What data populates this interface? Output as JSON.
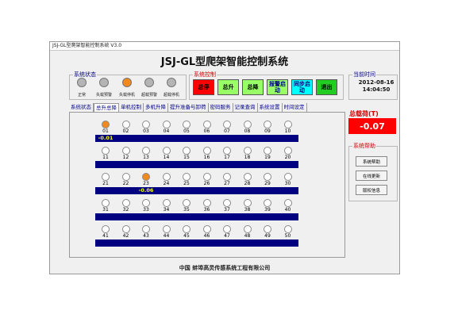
{
  "window": {
    "title": "JSJ-GL型爬架智能控制系统 V3.0"
  },
  "main_title": "JSJ-GL型爬架智能控制系统",
  "status_group": {
    "label": "系统状态",
    "lamps": [
      {
        "label": "正常",
        "color": "#b4b4b4"
      },
      {
        "label": "失载预警",
        "color": "#b4b4b4"
      },
      {
        "label": "失载停机",
        "color": "#f08a1e"
      },
      {
        "label": "超载预警",
        "color": "#b4b4b4"
      },
      {
        "label": "超载停机",
        "color": "#b4b4b4"
      }
    ]
  },
  "control_group": {
    "label": "系统控制",
    "buttons": [
      {
        "label": "总停",
        "bg": "#ff0000",
        "fg": "#000000"
      },
      {
        "label": "总升",
        "bg": "#99ff66",
        "fg": "#000000"
      },
      {
        "label": "总降",
        "bg": "#99ff66",
        "fg": "#000000"
      },
      {
        "label": "报警启动",
        "bg": "#99ff66",
        "fg": "#000080"
      },
      {
        "label": "同步启动",
        "bg": "#00ffff",
        "fg": "#000080"
      },
      {
        "label": "退出",
        "bg": "#22cc22",
        "fg": "#000000"
      }
    ]
  },
  "time_group": {
    "label": "当前时间",
    "date": "2012-08-16",
    "time": "14:04:50"
  },
  "tabs": [
    "系统状态",
    "总升总降",
    "单机控制",
    "多机升降",
    "提升准备与卸荷",
    "密码服务",
    "记录查询",
    "系统设置",
    "时间设定"
  ],
  "active_tab": 1,
  "units": [
    {
      "id": "01",
      "lamp": "#f08a1e",
      "value": "-0.01"
    },
    {
      "id": "02",
      "lamp": "#ffffff",
      "value": ""
    },
    {
      "id": "03",
      "lamp": "#ffffff",
      "value": ""
    },
    {
      "id": "04",
      "lamp": "#ffffff",
      "value": ""
    },
    {
      "id": "05",
      "lamp": "#ffffff",
      "value": ""
    },
    {
      "id": "06",
      "lamp": "#ffffff",
      "value": ""
    },
    {
      "id": "07",
      "lamp": "#ffffff",
      "value": ""
    },
    {
      "id": "08",
      "lamp": "#ffffff",
      "value": ""
    },
    {
      "id": "09",
      "lamp": "#ffffff",
      "value": ""
    },
    {
      "id": "10",
      "lamp": "#ffffff",
      "value": ""
    },
    {
      "id": "11",
      "lamp": "#ffffff",
      "value": ""
    },
    {
      "id": "12",
      "lamp": "#ffffff",
      "value": ""
    },
    {
      "id": "13",
      "lamp": "#ffffff",
      "value": ""
    },
    {
      "id": "14",
      "lamp": "#ffffff",
      "value": ""
    },
    {
      "id": "15",
      "lamp": "#ffffff",
      "value": ""
    },
    {
      "id": "16",
      "lamp": "#ffffff",
      "value": ""
    },
    {
      "id": "17",
      "lamp": "#ffffff",
      "value": ""
    },
    {
      "id": "18",
      "lamp": "#ffffff",
      "value": ""
    },
    {
      "id": "19",
      "lamp": "#ffffff",
      "value": ""
    },
    {
      "id": "20",
      "lamp": "#ffffff",
      "value": ""
    },
    {
      "id": "21",
      "lamp": "#ffffff",
      "value": ""
    },
    {
      "id": "22",
      "lamp": "#ffffff",
      "value": ""
    },
    {
      "id": "23",
      "lamp": "#f08a1e",
      "value": "-0.06"
    },
    {
      "id": "24",
      "lamp": "#ffffff",
      "value": ""
    },
    {
      "id": "25",
      "lamp": "#ffffff",
      "value": ""
    },
    {
      "id": "26",
      "lamp": "#ffffff",
      "value": ""
    },
    {
      "id": "27",
      "lamp": "#ffffff",
      "value": ""
    },
    {
      "id": "28",
      "lamp": "#ffffff",
      "value": ""
    },
    {
      "id": "29",
      "lamp": "#ffffff",
      "value": ""
    },
    {
      "id": "30",
      "lamp": "#ffffff",
      "value": ""
    },
    {
      "id": "31",
      "lamp": "#ffffff",
      "value": ""
    },
    {
      "id": "32",
      "lamp": "#ffffff",
      "value": ""
    },
    {
      "id": "33",
      "lamp": "#ffffff",
      "value": ""
    },
    {
      "id": "34",
      "lamp": "#ffffff",
      "value": ""
    },
    {
      "id": "35",
      "lamp": "#ffffff",
      "value": ""
    },
    {
      "id": "36",
      "lamp": "#ffffff",
      "value": ""
    },
    {
      "id": "37",
      "lamp": "#ffffff",
      "value": ""
    },
    {
      "id": "38",
      "lamp": "#ffffff",
      "value": ""
    },
    {
      "id": "39",
      "lamp": "#ffffff",
      "value": ""
    },
    {
      "id": "40",
      "lamp": "#ffffff",
      "value": ""
    },
    {
      "id": "41",
      "lamp": "#ffffff",
      "value": ""
    },
    {
      "id": "42",
      "lamp": "#ffffff",
      "value": ""
    },
    {
      "id": "43",
      "lamp": "#ffffff",
      "value": ""
    },
    {
      "id": "44",
      "lamp": "#ffffff",
      "value": ""
    },
    {
      "id": "45",
      "lamp": "#ffffff",
      "value": ""
    },
    {
      "id": "46",
      "lamp": "#ffffff",
      "value": ""
    },
    {
      "id": "47",
      "lamp": "#ffffff",
      "value": ""
    },
    {
      "id": "48",
      "lamp": "#ffffff",
      "value": ""
    },
    {
      "id": "49",
      "lamp": "#ffffff",
      "value": ""
    },
    {
      "id": "50",
      "lamp": "#ffffff",
      "value": ""
    }
  ],
  "total_load": {
    "label": "总载荷(T)",
    "value": "-0.07"
  },
  "help_group": {
    "label": "系统帮助",
    "buttons": [
      "系统帮助",
      "在线更新",
      "版权信息"
    ]
  },
  "footer": "中国  蚌埠高灵传感系统工程有限公司"
}
